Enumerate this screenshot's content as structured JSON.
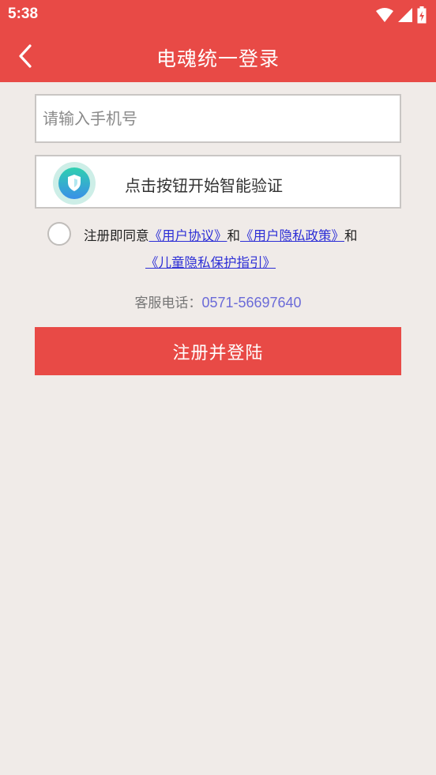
{
  "status_bar": {
    "time": "5:38",
    "icons": [
      "wifi-icon",
      "signal-icon",
      "battery-icon"
    ]
  },
  "app_bar": {
    "back_icon": "chevron-left-icon",
    "title": "电魂统一登录"
  },
  "form": {
    "phone_placeholder": "请输入手机号",
    "phone_value": "",
    "verify_icon": "shield-icon",
    "verify_label": "点击按钮开始智能验证"
  },
  "agreement": {
    "checked": false,
    "prefix": "注册即同意",
    "user_agreement": "《用户协议》",
    "and1": "和",
    "privacy_policy": "《用户隐私政策》",
    "and2": "和",
    "children_privacy": "《儿童隐私保护指引》"
  },
  "service": {
    "label": "客服电话：",
    "phone": "0571-56697640"
  },
  "submit": {
    "label": "注册并登陆"
  },
  "colors": {
    "primary": "#e84a46",
    "background": "#f0ebe8",
    "link": "#2d2fd6",
    "service_phone": "#6b6bd8"
  }
}
